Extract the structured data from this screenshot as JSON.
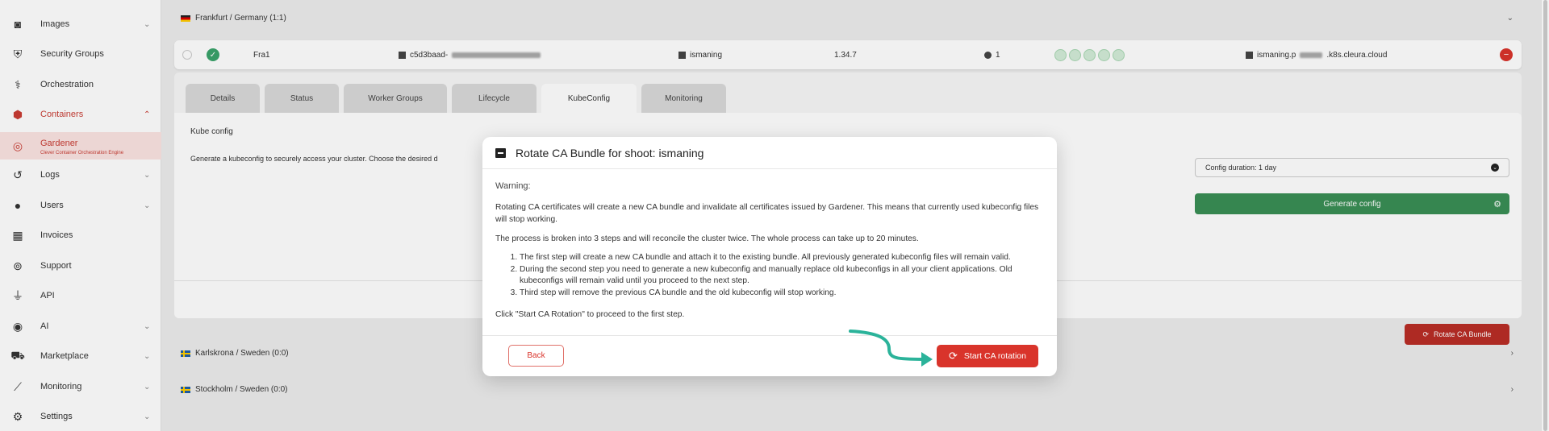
{
  "sidebar": {
    "items": [
      {
        "label": "Images",
        "icon": "camera-icon"
      },
      {
        "label": "Security Groups",
        "icon": "shield-icon"
      },
      {
        "label": "Orchestration",
        "icon": "orchestration-icon"
      },
      {
        "label": "Containers",
        "icon": "containers-icon"
      },
      {
        "label": "Gardener",
        "sub": "Clever Container Orchestration Engine",
        "icon": "gardener-icon"
      },
      {
        "label": "Logs",
        "icon": "history-icon"
      },
      {
        "label": "Users",
        "icon": "user-icon"
      },
      {
        "label": "Invoices",
        "icon": "calculator-icon"
      },
      {
        "label": "Support",
        "icon": "lifebuoy-icon"
      },
      {
        "label": "API",
        "icon": "plug-icon"
      },
      {
        "label": "AI",
        "icon": "ai-icon"
      },
      {
        "label": "Marketplace",
        "icon": "cart-icon"
      },
      {
        "label": "Monitoring",
        "icon": "chart-icon"
      },
      {
        "label": "Settings",
        "icon": "gear-icon"
      }
    ]
  },
  "regions": {
    "frankfurt": "Frankfurt / Germany (1:1)",
    "karlskrona": "Karlskrona / Sweden (0:0)",
    "stockholm": "Stockholm / Sweden (0:0)"
  },
  "cluster": {
    "name": "Fra1",
    "id_prefix": "c5d3baad-",
    "project": "ismaning",
    "version": "1.34.7",
    "nodes": "1",
    "endpoint_prefix": "ismaning.p",
    "endpoint_suffix": ".k8s.cleura.cloud"
  },
  "tabs": [
    "Details",
    "Status",
    "Worker Groups",
    "Lifecycle",
    "KubeConfig",
    "Monitoring"
  ],
  "kubeconfig": {
    "title": "Kube config",
    "description": "Generate a kubeconfig to securely access your cluster. Choose the desired d",
    "duration": "Config duration: 1 day",
    "generate_label": "Generate config",
    "rotate_label": "Rotate CA Bundle"
  },
  "modal": {
    "title": "Rotate CA Bundle for shoot: ismaning",
    "warning": "Warning:",
    "para1": "Rotating CA certificates will create a new CA bundle and invalidate all certificates issued by Gardener. This means that currently used kubeconfig files will stop working.",
    "para2": "The process is broken into 3 steps and will reconcile the cluster twice. The whole process can take up to 20 minutes.",
    "steps": [
      "The first step will create a new CA bundle and attach it to the existing bundle. All previously generated kubeconfig files will remain valid.",
      "During the second step you need to generate a new kubeconfig and manually replace old kubeconfigs in all your client applications. Old kubeconfigs will remain valid until you proceed to the next step.",
      "Third step will remove the previous CA bundle and the old kubeconfig will stop working."
    ],
    "para3": "Click \"Start CA Rotation\" to proceed to the first step.",
    "back_label": "Back",
    "start_label": "Start CA rotation"
  },
  "colors": {
    "accent_red": "#d9342b",
    "success_green": "#3a8f55",
    "arrow_teal": "#2bb39a"
  }
}
